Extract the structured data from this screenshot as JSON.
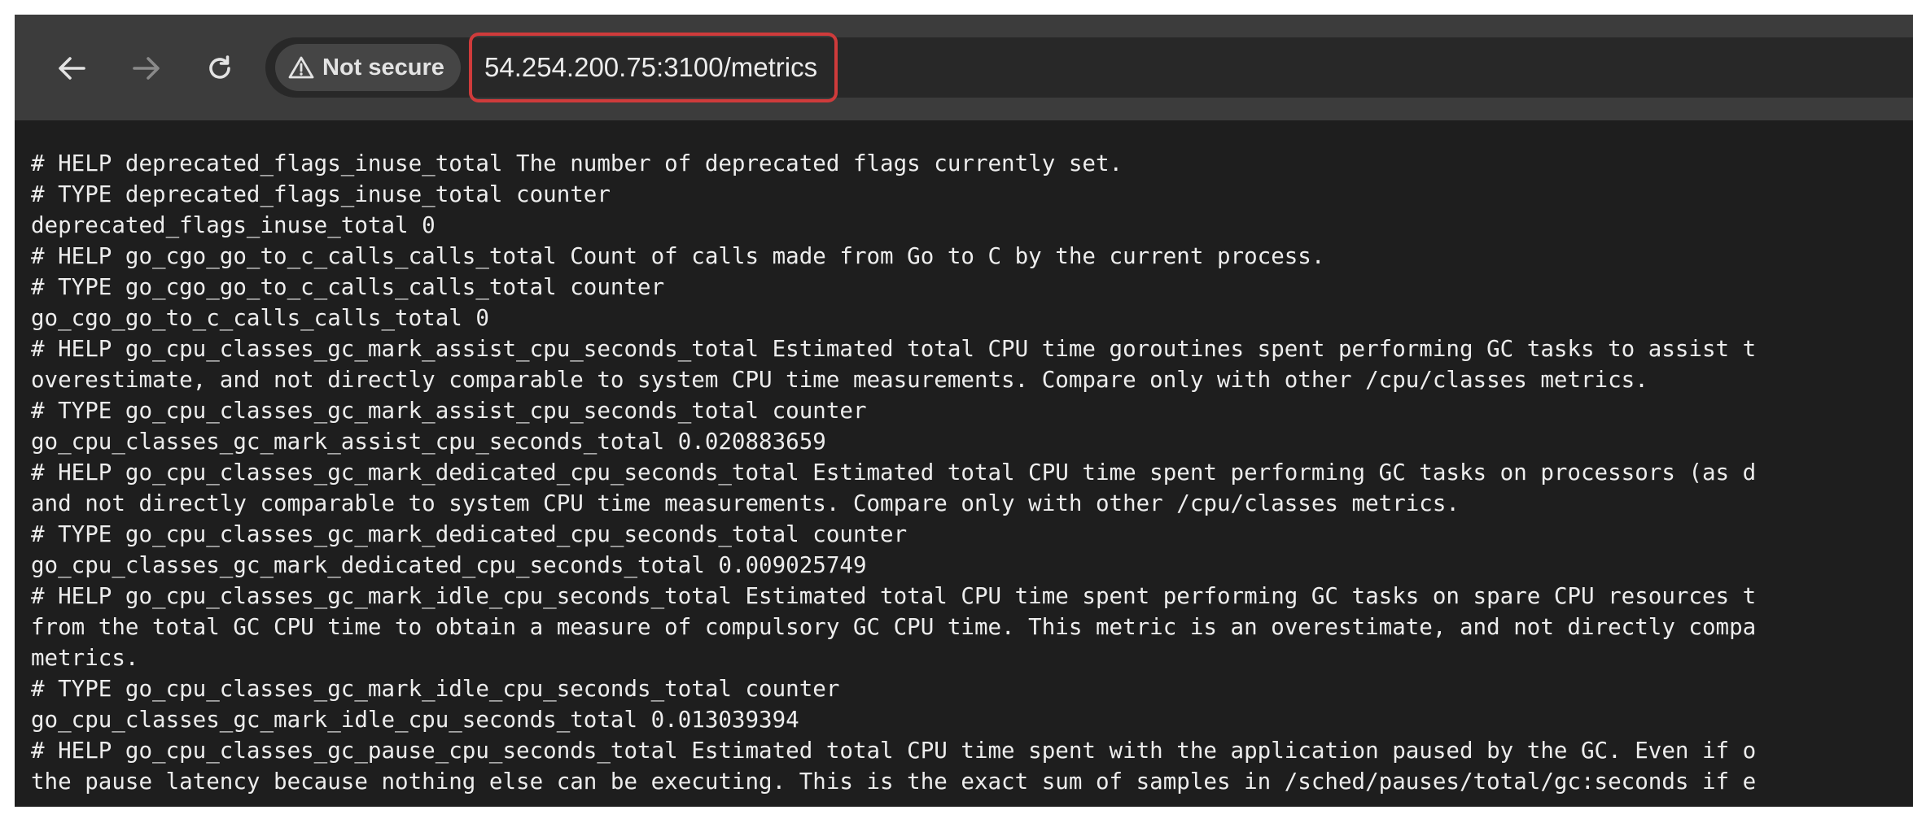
{
  "address_bar": {
    "security_label": "Not secure",
    "url": "54.254.200.75:3100/metrics"
  },
  "icons": {
    "back": "arrow-left-icon",
    "forward": "arrow-right-icon",
    "reload": "reload-icon",
    "security": "warning-triangle-icon"
  },
  "colors": {
    "toolbar": "#3c3c3c",
    "page_background": "#1e1e1e",
    "highlight_border": "#cf3b3b",
    "text": "#ededed"
  },
  "metrics_lines": [
    "# HELP deprecated_flags_inuse_total The number of deprecated flags currently set.",
    "# TYPE deprecated_flags_inuse_total counter",
    "deprecated_flags_inuse_total 0",
    "# HELP go_cgo_go_to_c_calls_calls_total Count of calls made from Go to C by the current process.",
    "# TYPE go_cgo_go_to_c_calls_calls_total counter",
    "go_cgo_go_to_c_calls_calls_total 0",
    "# HELP go_cpu_classes_gc_mark_assist_cpu_seconds_total Estimated total CPU time goroutines spent performing GC tasks to assist t",
    "overestimate, and not directly comparable to system CPU time measurements. Compare only with other /cpu/classes metrics.",
    "# TYPE go_cpu_classes_gc_mark_assist_cpu_seconds_total counter",
    "go_cpu_classes_gc_mark_assist_cpu_seconds_total 0.020883659",
    "# HELP go_cpu_classes_gc_mark_dedicated_cpu_seconds_total Estimated total CPU time spent performing GC tasks on processors (as d",
    "and not directly comparable to system CPU time measurements. Compare only with other /cpu/classes metrics.",
    "# TYPE go_cpu_classes_gc_mark_dedicated_cpu_seconds_total counter",
    "go_cpu_classes_gc_mark_dedicated_cpu_seconds_total 0.009025749",
    "# HELP go_cpu_classes_gc_mark_idle_cpu_seconds_total Estimated total CPU time spent performing GC tasks on spare CPU resources t",
    "from the total GC CPU time to obtain a measure of compulsory GC CPU time. This metric is an overestimate, and not directly compa",
    "metrics.",
    "# TYPE go_cpu_classes_gc_mark_idle_cpu_seconds_total counter",
    "go_cpu_classes_gc_mark_idle_cpu_seconds_total 0.013039394",
    "# HELP go_cpu_classes_gc_pause_cpu_seconds_total Estimated total CPU time spent with the application paused by the GC. Even if o",
    "the pause latency because nothing else can be executing. This is the exact sum of samples in /sched/pauses/total/gc:seconds if e"
  ]
}
